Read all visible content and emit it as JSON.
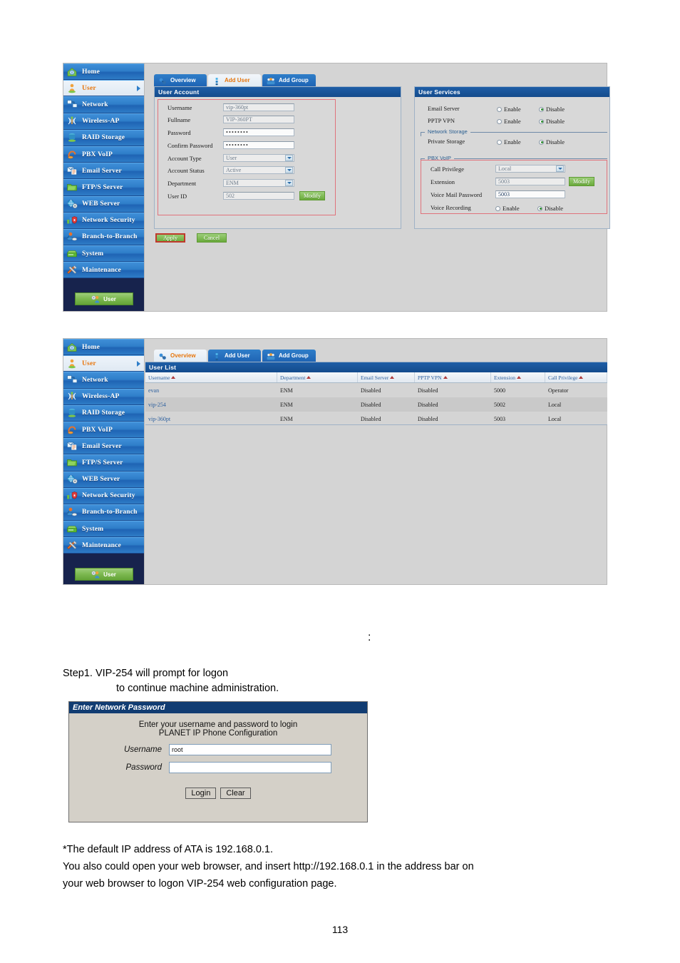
{
  "document": {
    "colon_marker": ":",
    "step_line1": "Step1. VIP-254 will prompt for logon",
    "step_line2": "to continue machine administration.",
    "note_line1": "*The default IP address of ATA is 192.168.0.1.",
    "note_line2": "You also could open your web browser, and insert http://192.168.0.1 in the address bar on",
    "note_line3": "your web browser to logon VIP-254 web configuration page.",
    "page_number": "113"
  },
  "sidebar": {
    "items": [
      {
        "label": "Home",
        "icon": "home-icon",
        "active": false
      },
      {
        "label": "User",
        "icon": "user-icon",
        "active": true
      },
      {
        "label": "Network",
        "icon": "network-icon",
        "active": false
      },
      {
        "label": "Wireless-AP",
        "icon": "wireless-icon",
        "active": false
      },
      {
        "label": "RAID Storage",
        "icon": "raid-storage-icon",
        "active": false
      },
      {
        "label": "PBX VoIP",
        "icon": "pbx-voip-icon",
        "active": false
      },
      {
        "label": "Email Server",
        "icon": "email-server-icon",
        "active": false
      },
      {
        "label": "FTP/S Server",
        "icon": "ftp-server-icon",
        "active": false
      },
      {
        "label": "WEB Server",
        "icon": "web-server-icon",
        "active": false
      },
      {
        "label": "Network Security",
        "icon": "network-security-icon",
        "active": false
      },
      {
        "label": "Branch-to-Branch",
        "icon": "branch-to-branch-icon",
        "active": false
      },
      {
        "label": "System",
        "icon": "system-icon",
        "active": false
      },
      {
        "label": "Maintenance",
        "icon": "maintenance-icon",
        "active": false
      }
    ],
    "footer_button": "User"
  },
  "tabs": [
    {
      "label": "Overview",
      "icon": "overview-icon"
    },
    {
      "label": "Add User",
      "icon": "add-user-icon"
    },
    {
      "label": "Add Group",
      "icon": "add-group-icon"
    }
  ],
  "screen1": {
    "selected_tab": "Add User",
    "user_account": {
      "title": "User Account",
      "fields": {
        "username_label": "Username",
        "username_value": "vip-360pt",
        "fullname_label": "Fullname",
        "fullname_value": "VIP-360PT",
        "password_label": "Password",
        "password_value": "••••••••",
        "confirm_password_label": "Confirm Password",
        "confirm_password_value": "••••••••",
        "account_type_label": "Account Type",
        "account_type_value": "User",
        "account_status_label": "Account Status",
        "account_status_value": "Active",
        "department_label": "Department",
        "department_value": "ENM",
        "user_id_label": "User ID",
        "user_id_value": "502",
        "user_id_modify": "Modify"
      },
      "apply_label": "Apply",
      "cancel_label": "Cancel"
    },
    "user_services": {
      "title": "User Services",
      "email_server_label": "Email Server",
      "email_server_enable": "Enable",
      "email_server_disable": "Disable",
      "email_server_selected": "Disable",
      "pptp_vpn_label": "PPTP VPN",
      "pptp_vpn_enable": "Enable",
      "pptp_vpn_disable": "Disable",
      "pptp_vpn_selected": "Disable",
      "network_storage_legend": "Network Storage",
      "private_storage_label": "Private Storage",
      "private_storage_enable": "Enable",
      "private_storage_disable": "Disable",
      "private_storage_selected": "Disable",
      "pbx_voip_legend": "PBX VoIP",
      "call_privilege_label": "Call Privilege",
      "call_privilege_value": "Local",
      "extension_label": "Extension",
      "extension_value": "5003",
      "extension_modify": "Modify",
      "voice_mail_password_label": "Voice Mail Password",
      "voice_mail_password_value": "5003",
      "voice_recording_label": "Voice Recording",
      "voice_recording_enable": "Enable",
      "voice_recording_disable": "Disable",
      "voice_recording_selected": "Disable"
    }
  },
  "screen2": {
    "selected_tab": "Overview",
    "user_list": {
      "title": "User List",
      "columns": [
        "Username",
        "Department",
        "Email Server",
        "PPTP VPN",
        "Extension",
        "Call Privilege"
      ],
      "rows": [
        [
          "evan",
          "ENM",
          "Disabled",
          "Disabled",
          "5000",
          "Operator"
        ],
        [
          "vip-254",
          "ENM",
          "Disabled",
          "Disabled",
          "5002",
          "Local"
        ],
        [
          "vip-360pt",
          "ENM",
          "Disabled",
          "Disabled",
          "5003",
          "Local"
        ]
      ]
    }
  },
  "login_dialog": {
    "title": "Enter Network Password",
    "prompt_line1": "Enter your username and password to login",
    "prompt_line2": "PLANET IP Phone Configuration",
    "username_label": "Username",
    "username_value": "root",
    "password_label": "Password",
    "password_value": "",
    "login_button": "Login",
    "clear_button": "Clear"
  },
  "colors": {
    "panel_header": "#144b8c",
    "sidebar_bg": "#17234d",
    "accent_orange": "#e8760d",
    "green_button": "#6aaa3c",
    "link_blue": "#2c5f9e",
    "redbox": "#e0737c"
  }
}
